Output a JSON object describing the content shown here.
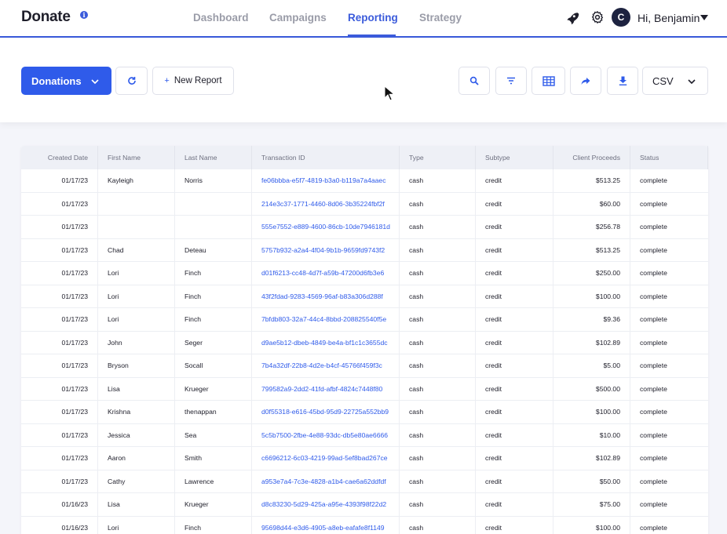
{
  "brand": {
    "logo": "Donate",
    "info_icon": "info-icon"
  },
  "nav": {
    "tabs": [
      {
        "label": "Dashboard"
      },
      {
        "label": "Campaigns"
      },
      {
        "label": "Reporting"
      },
      {
        "label": "Strategy"
      }
    ],
    "active_tab": "Reporting",
    "icons": [
      "rocket-icon",
      "gear-icon"
    ],
    "user": {
      "initial": "C",
      "greeting": "Hi, Benjamin"
    }
  },
  "toolbar": {
    "report_type": "Donations",
    "new_report_label": "New Report",
    "format": "CSV",
    "icons": [
      "refresh-icon",
      "search-icon",
      "filter-icon",
      "table-icon",
      "share-icon",
      "download-icon"
    ]
  },
  "colors": {
    "accent": "#2f5bea",
    "link": "#2f5bea",
    "header_bg": "#eef0f6"
  },
  "table": {
    "columns": [
      "Created Date",
      "First Name",
      "Last Name",
      "Transaction ID",
      "Type",
      "Subtype",
      "Client Proceeds",
      "Status"
    ],
    "rows": [
      {
        "date": "01/17/23",
        "first": "Kayleigh",
        "last": "Norris",
        "tid": "fe06bbba-e5f7-4819-b3a0-b119a7a4aaec",
        "type": "cash",
        "subtype": "credit",
        "proceeds": "$513.25",
        "status": "complete"
      },
      {
        "date": "01/17/23",
        "first": "",
        "last": "",
        "tid": "214e3c37-1771-4460-8d06-3b35224fbf2f",
        "type": "cash",
        "subtype": "credit",
        "proceeds": "$60.00",
        "status": "complete"
      },
      {
        "date": "01/17/23",
        "first": "",
        "last": "",
        "tid": "555e7552-e889-4600-86cb-10de7946181d",
        "type": "cash",
        "subtype": "credit",
        "proceeds": "$256.78",
        "status": "complete"
      },
      {
        "date": "01/17/23",
        "first": "Chad",
        "last": "Deteau",
        "tid": "5757b932-a2a4-4f04-9b1b-9659fd9743f2",
        "type": "cash",
        "subtype": "credit",
        "proceeds": "$513.25",
        "status": "complete"
      },
      {
        "date": "01/17/23",
        "first": "Lori",
        "last": "Finch",
        "tid": "d01f6213-cc48-4d7f-a59b-47200d6fb3e6",
        "type": "cash",
        "subtype": "credit",
        "proceeds": "$250.00",
        "status": "complete"
      },
      {
        "date": "01/17/23",
        "first": "Lori",
        "last": "Finch",
        "tid": "43f2fdad-9283-4569-96af-b83a306d288f",
        "type": "cash",
        "subtype": "credit",
        "proceeds": "$100.00",
        "status": "complete"
      },
      {
        "date": "01/17/23",
        "first": "Lori",
        "last": "Finch",
        "tid": "7bfdb803-32a7-44c4-8bbd-208825540f5e",
        "type": "cash",
        "subtype": "credit",
        "proceeds": "$9.36",
        "status": "complete"
      },
      {
        "date": "01/17/23",
        "first": "John",
        "last": "Seger",
        "tid": "d9ae5b12-dbeb-4849-be4a-bf1c1c3655dc",
        "type": "cash",
        "subtype": "credit",
        "proceeds": "$102.89",
        "status": "complete"
      },
      {
        "date": "01/17/23",
        "first": "Bryson",
        "last": "Socall",
        "tid": "7b4a32df-22b8-4d2e-b4cf-45766f459f3c",
        "type": "cash",
        "subtype": "credit",
        "proceeds": "$5.00",
        "status": "complete"
      },
      {
        "date": "01/17/23",
        "first": "Lisa",
        "last": "Krueger",
        "tid": "799582a9-2dd2-41fd-afbf-4824c7448f80",
        "type": "cash",
        "subtype": "credit",
        "proceeds": "$500.00",
        "status": "complete"
      },
      {
        "date": "01/17/23",
        "first": "Krishna",
        "last": "thenappan",
        "tid": "d0f55318-e616-45bd-95d9-22725a552bb9",
        "type": "cash",
        "subtype": "credit",
        "proceeds": "$100.00",
        "status": "complete"
      },
      {
        "date": "01/17/23",
        "first": "Jessica",
        "last": "Sea",
        "tid": "5c5b7500-2fbe-4e88-93dc-db5e80ae6666",
        "type": "cash",
        "subtype": "credit",
        "proceeds": "$10.00",
        "status": "complete"
      },
      {
        "date": "01/17/23",
        "first": "Aaron",
        "last": "Smith",
        "tid": "c6696212-6c03-4219-99ad-5ef8bad267ce",
        "type": "cash",
        "subtype": "credit",
        "proceeds": "$102.89",
        "status": "complete"
      },
      {
        "date": "01/17/23",
        "first": "Cathy",
        "last": "Lawrence",
        "tid": "a953e7a4-7c3e-4828-a1b4-cae6a62ddfdf",
        "type": "cash",
        "subtype": "credit",
        "proceeds": "$50.00",
        "status": "complete"
      },
      {
        "date": "01/16/23",
        "first": "Lisa",
        "last": "Krueger",
        "tid": "d8c83230-5d29-425a-a95e-4393f98f22d2",
        "type": "cash",
        "subtype": "credit",
        "proceeds": "$75.00",
        "status": "complete"
      },
      {
        "date": "01/16/23",
        "first": "Lori",
        "last": "Finch",
        "tid": "95698d44-e3d6-4905-a8eb-eafafe8f1149",
        "type": "cash",
        "subtype": "credit",
        "proceeds": "$100.00",
        "status": "complete"
      }
    ]
  }
}
